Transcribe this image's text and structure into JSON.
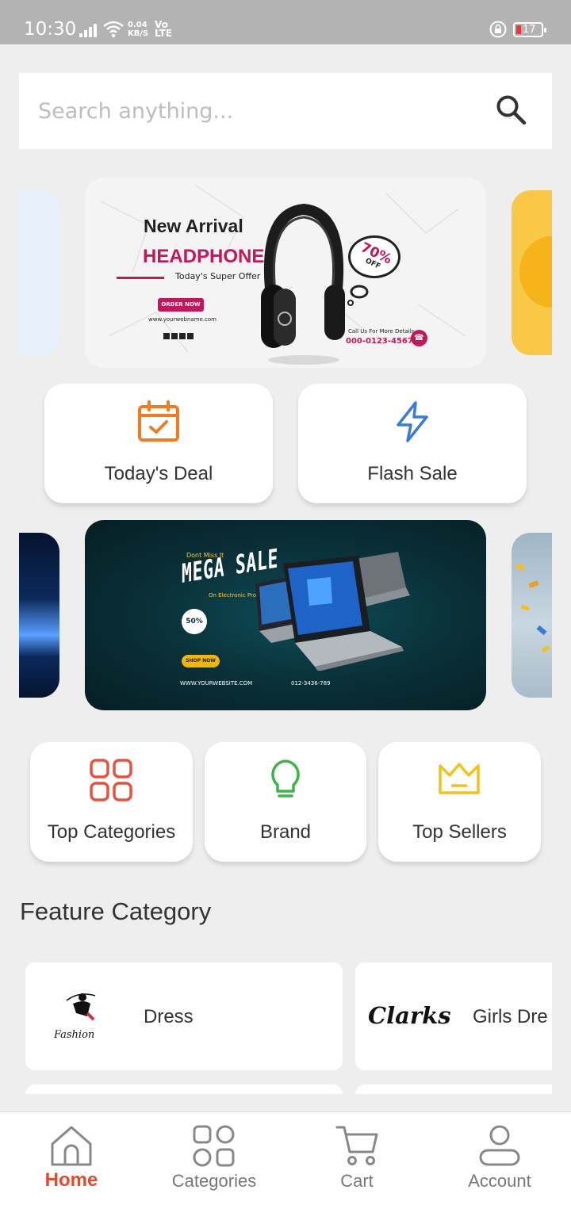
{
  "status_bar": {
    "time": "10:30",
    "net_speed_value": "0.04",
    "net_speed_unit": "KB/S",
    "network_top": "Vo",
    "network_bottom": "LTE",
    "battery": "17"
  },
  "search": {
    "placeholder": "Search anything..."
  },
  "banner_top": {
    "title": "New Arrival",
    "product": "HEADPHONE",
    "offer": "Today's Super Offer",
    "cta": "ORDER NOW",
    "website": "www.yourwebname.com",
    "discount": "70%",
    "discount_suffix": "OFF",
    "call_label": "Call Us For More Details",
    "phone": "000-0123-4567"
  },
  "banner_bottom": {
    "kicker": "Dont Miss It",
    "title": "MEGA SALE",
    "subtitle": "On Electronic Products",
    "discount": "50%",
    "cta": "SHOP NOW",
    "website": "WWW.YOURWEBSITE.COM",
    "phone": "012-3436-789"
  },
  "quick_actions": [
    {
      "label": "Today's Deal",
      "icon": "calendar-check-icon",
      "color": "#f07b22"
    },
    {
      "label": "Flash Sale",
      "icon": "lightning-icon",
      "color": "#3a7bd5"
    }
  ],
  "shortcuts": [
    {
      "label": "Top Categories",
      "icon": "grid-icon",
      "color": "#e55340"
    },
    {
      "label": "Brand",
      "icon": "lightbulb-icon",
      "color": "#3bb54a"
    },
    {
      "label": "Top Sellers",
      "icon": "crown-icon",
      "color": "#f2c21b"
    }
  ],
  "feature_category": {
    "title": "Feature Category",
    "items": [
      {
        "name": "Dress",
        "logo_text": "Fashion"
      },
      {
        "name": "Girls Dre",
        "logo_text": "Clarks"
      }
    ]
  },
  "bottom_nav": {
    "items": [
      {
        "label": "Home",
        "icon": "home-icon",
        "active": true
      },
      {
        "label": "Categories",
        "icon": "categories-icon",
        "active": false
      },
      {
        "label": "Cart",
        "icon": "cart-icon",
        "active": false
      },
      {
        "label": "Account",
        "icon": "account-icon",
        "active": false
      }
    ]
  },
  "colors": {
    "accent": "#e8492a",
    "background": "#eeeeee"
  }
}
